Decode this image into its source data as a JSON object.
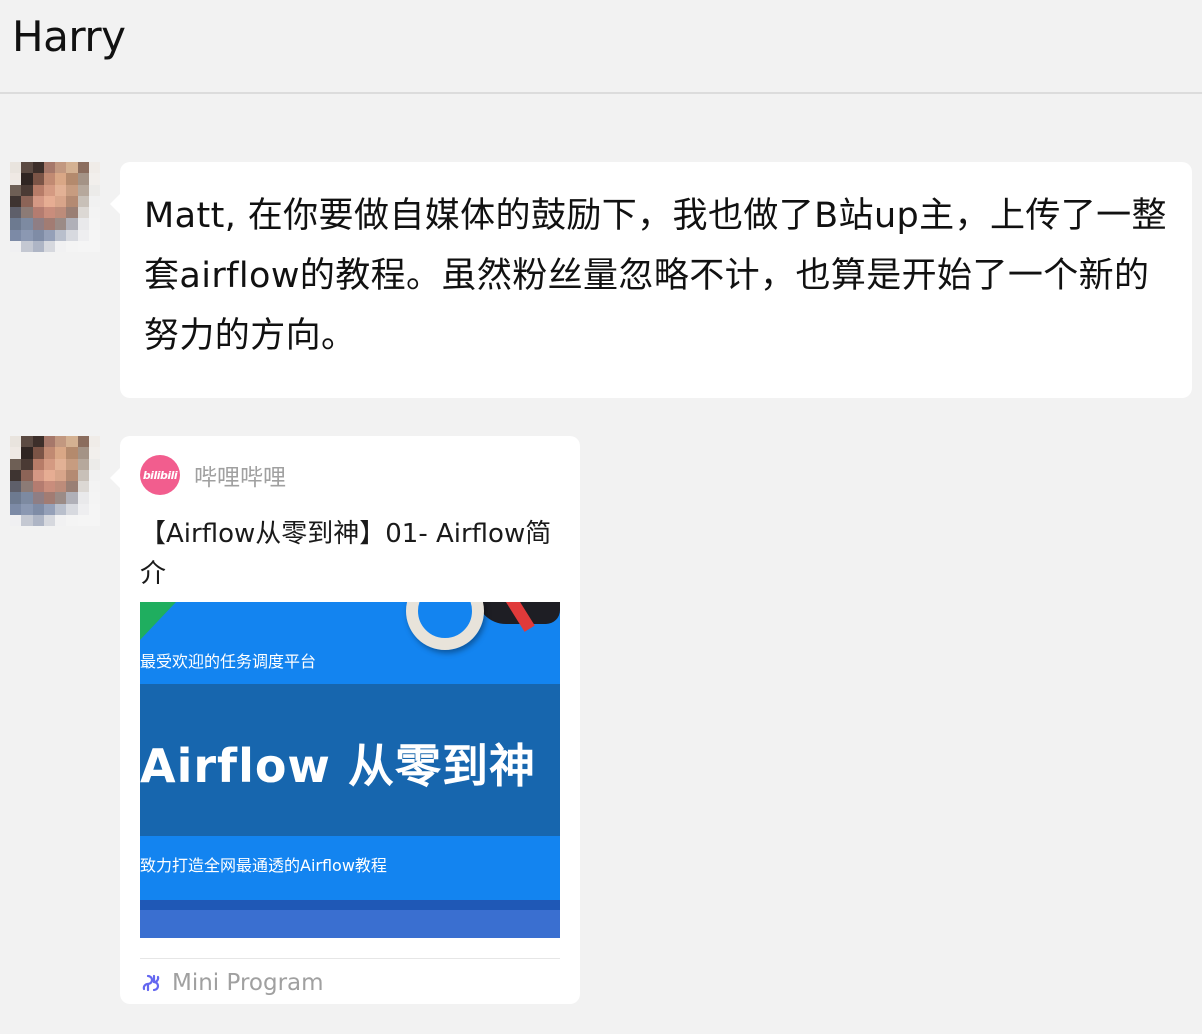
{
  "header": {
    "title": "Harry"
  },
  "messages": [
    {
      "type": "text",
      "text": "Matt, 在你要做自媒体的鼓励下，我也做了B站up主，上传了一整套airflow的教程。虽然粉丝量忽略不计，也算是开始了一个新的努力的方向。"
    },
    {
      "type": "mini_program_card",
      "source_name": "哔哩哔哩",
      "logo_text": "bilibili",
      "title": "【Airflow从零到神】01- Airflow简介",
      "thumbnail": {
        "subtitle_top": "最受欢迎的任务调度平台",
        "headline": "Airflow 从零到神",
        "subtitle_bottom": "致力打造全网最通透的Airflow教程"
      },
      "footer_label": "Mini Program"
    }
  ],
  "colors": {
    "background": "#f2f2f2",
    "bubble": "#ffffff",
    "bilibili_pink": "#f25d8e",
    "mini_program_purple": "#6467f0",
    "muted_text": "#a0a0a0"
  },
  "icons": {
    "source_logo": "bilibili-logo-icon",
    "footer": "mini-program-icon"
  }
}
